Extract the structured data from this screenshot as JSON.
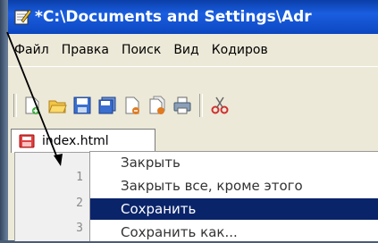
{
  "window": {
    "title": "*C:\\Documents and Settings\\Adr"
  },
  "menubar": {
    "items": [
      "Файл",
      "Правка",
      "Поиск",
      "Вид",
      "Кодиров"
    ]
  },
  "toolbar": {
    "icons": [
      "new-file-icon",
      "open-folder-icon",
      "save-icon",
      "save-all-icon",
      "close-icon",
      "close-all-icon",
      "print-icon",
      "cut-icon"
    ]
  },
  "tab": {
    "label": "index.html"
  },
  "gutter": {
    "lines": [
      "1",
      "2",
      "3"
    ]
  },
  "context_menu": {
    "items": [
      {
        "label": "Закрыть",
        "selected": false
      },
      {
        "label": "Закрыть все, кроме этого",
        "selected": false
      },
      {
        "label": "Сохранить",
        "selected": true
      },
      {
        "label": "Сохранить как...",
        "selected": false
      }
    ]
  },
  "colors": {
    "titlebar": "#0c46c0",
    "menu_selection": "#0a246a",
    "chrome": "#ece9d8"
  }
}
